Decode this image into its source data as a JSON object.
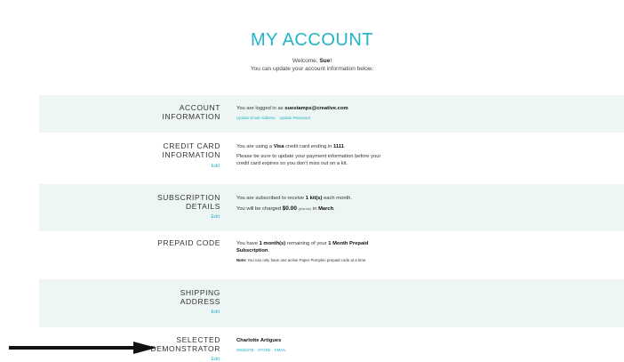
{
  "page": {
    "title": "MY ACCOUNT",
    "welcome_prefix": "Welcome, ",
    "user_name": "Sue",
    "welcome_suffix": "!",
    "subtitle": "You can update your account information below."
  },
  "account": {
    "label_line1": "ACCOUNT",
    "label_line2": "INFORMATION",
    "logged_in_prefix": "You are logged in as ",
    "email": "suestamps@creative.com",
    "update_email": "Update Email Address",
    "update_password": "Update Password"
  },
  "credit_card": {
    "label_line1": "CREDIT CARD",
    "label_line2": "INFORMATION",
    "edit": "Edit",
    "using_prefix": "You are using a ",
    "card_type": "Visa",
    "ending_text": " credit card ending in ",
    "last_four": "1111",
    "period": ".",
    "reminder_line1": "Please be sure to update your payment information before your",
    "reminder_line2": "credit card expires so you don't miss out on a kit."
  },
  "subscription": {
    "label_line1": "SUBSCRIPTION",
    "label_line2": "DETAILS",
    "edit": "Edit",
    "receive_prefix": "You are subscribed to receive ",
    "kit_count": "1  kit(s)",
    "receive_suffix": " each month.",
    "charged_prefix": "You will be charged ",
    "amount": "$0.00",
    "tax_note": "(plus tax)",
    "in_text": " in ",
    "month": "March",
    "period": "."
  },
  "prepaid": {
    "label": "PREPAID CODE",
    "have_prefix": "You have ",
    "months": "1  month(s)",
    "remaining_text": " remaining of your ",
    "plan": "1 Month Prepaid",
    "plan_line2": "Subscription",
    "period": ".",
    "note_label": "Note:",
    "note_text": " You can only have one active Paper Pumpkin prepaid code at a time."
  },
  "shipping": {
    "label_line1": "SHIPPING",
    "label_line2": "ADDRESS",
    "edit": "Edit"
  },
  "demonstrator": {
    "label_line1": "SELECTED",
    "label_line2": "DEMONSTRATOR",
    "edit": "Edit",
    "name": "Charlotte Artigues",
    "website": "WEBSITE",
    "store": "STORE",
    "email": "EMAIL",
    "separator": "·"
  },
  "colors": {
    "accent": "#22b5c7",
    "section_bg": "#eef5f5",
    "arrow": "#111111"
  }
}
